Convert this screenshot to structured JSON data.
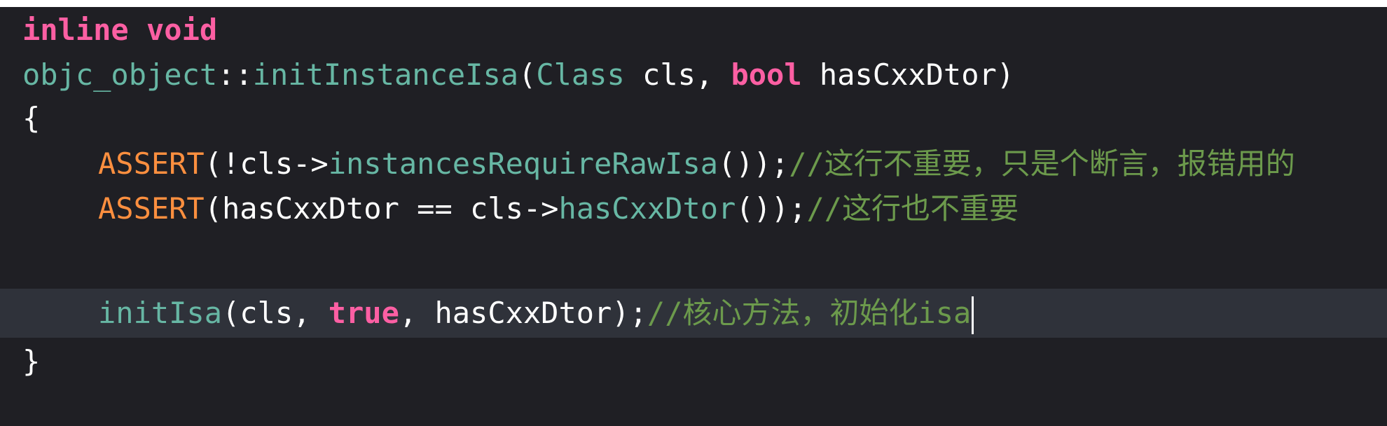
{
  "editor": {
    "colors": {
      "background": "#1f1f24",
      "highlighted_line": "#2f323a",
      "keyword": "#fc5fa3",
      "function": "#67b7a4",
      "macro": "#fd8f3f",
      "comment": "#6c9a4c",
      "plain": "#ffffff"
    },
    "lines": [
      {
        "tokens": [
          {
            "type": "kw",
            "text": "inline"
          },
          {
            "type": "plain",
            "text": " "
          },
          {
            "type": "kw",
            "text": "void"
          }
        ]
      },
      {
        "tokens": [
          {
            "type": "fn",
            "text": "objc_object"
          },
          {
            "type": "plain",
            "text": "::"
          },
          {
            "type": "fn",
            "text": "initInstanceIsa"
          },
          {
            "type": "plain",
            "text": "("
          },
          {
            "type": "fn",
            "text": "Class"
          },
          {
            "type": "plain",
            "text": " cls, "
          },
          {
            "type": "kw",
            "text": "bool"
          },
          {
            "type": "plain",
            "text": " hasCxxDtor)"
          }
        ]
      },
      {
        "tokens": [
          {
            "type": "plain",
            "text": "{"
          }
        ]
      },
      {
        "tokens": [
          {
            "type": "macro",
            "text": "ASSERT"
          },
          {
            "type": "plain",
            "text": "(!cls->"
          },
          {
            "type": "fn",
            "text": "instancesRequireRawIsa"
          },
          {
            "type": "plain",
            "text": "());"
          },
          {
            "type": "comment",
            "text": "//这行不重要，只是个断言，报错用的"
          }
        ]
      },
      {
        "tokens": [
          {
            "type": "macro",
            "text": "ASSERT"
          },
          {
            "type": "plain",
            "text": "(hasCxxDtor == cls->"
          },
          {
            "type": "fn",
            "text": "hasCxxDtor"
          },
          {
            "type": "plain",
            "text": "());"
          },
          {
            "type": "comment",
            "text": "//这行也不重要"
          }
        ]
      },
      {
        "tokens": []
      },
      {
        "tokens": [
          {
            "type": "fn",
            "text": "initIsa"
          },
          {
            "type": "plain",
            "text": "(cls, "
          },
          {
            "type": "kw",
            "text": "true"
          },
          {
            "type": "plain",
            "text": ", hasCxxDtor);"
          },
          {
            "type": "comment",
            "text": "//核心方法，初始化isa"
          }
        ]
      },
      {
        "tokens": [
          {
            "type": "plain",
            "text": "}"
          }
        ]
      }
    ]
  }
}
